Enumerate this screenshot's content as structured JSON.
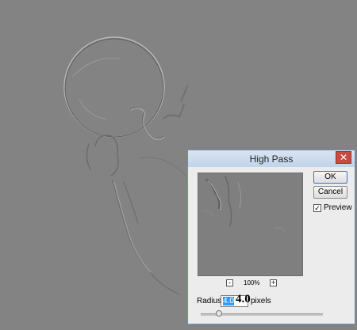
{
  "dialog": {
    "title": "High Pass",
    "close_glyph": "✕",
    "ok_label": "OK",
    "cancel_label": "Cancel",
    "preview_label": "Preview",
    "preview_checked": "✓",
    "zoom_out_glyph": "-",
    "zoom_in_glyph": "+",
    "zoom_level": "100%",
    "radius_label": "Radius:",
    "radius_value": "4.0",
    "radius_value_large": "4.0",
    "radius_units": "pixels",
    "slider_level_fraction": 0.15
  },
  "colors": {
    "canvas_gray": "#838383",
    "dialog_bg": "#ececec",
    "title_bar": "#c8d8ec",
    "close_red": "#c94a3e",
    "selection_blue": "#3399ff"
  },
  "icons": [
    "close-icon",
    "checkbox-icon",
    "zoom-out-icon",
    "zoom-in-icon"
  ]
}
